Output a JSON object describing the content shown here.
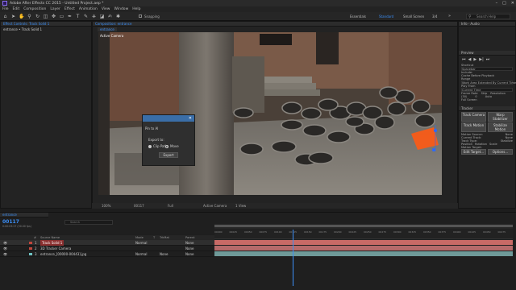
{
  "window": {
    "title": "Adobe After Effects CC 2015 - Untitled Project.aep *",
    "controls": [
      "–",
      "□",
      "✕"
    ]
  },
  "menu": [
    "File",
    "Edit",
    "Composition",
    "Layer",
    "Effect",
    "Animation",
    "View",
    "Window",
    "Help"
  ],
  "toolbar": {
    "snapping_label": "Snapping",
    "workspaces": [
      "Essentials",
      "Standard",
      "Small Screen",
      "3/4"
    ],
    "active_workspace": "Standard",
    "search_placeholder": "Search Help"
  },
  "effect_controls": {
    "tab": "Effect Controls: Track Solid 1",
    "layer": "entrance • Track Solid 1"
  },
  "composition": {
    "tab": "Composition: entrance",
    "comp_label": "entrance",
    "camera_label": "Active Camera",
    "footer": {
      "zoom": "100%",
      "timecode": "00117",
      "resolution": "Full",
      "view": "Active Camera",
      "views": "1 View"
    }
  },
  "dialog": {
    "title": "Pin to Al",
    "subtitle": "Export to:",
    "options": [
      "Clip Path",
      "Move"
    ],
    "selected": "Clip Path",
    "button": "Export"
  },
  "right_panel": {
    "info_tab": "Info",
    "audio_tab": "Audio",
    "preview_tab": "Preview",
    "shortcut_label": "Shortcut",
    "shortcut_value": "Spacebar",
    "include_label": "Include:",
    "cache_label": "Cache Before Playback",
    "range_label": "Range",
    "range_value": "Work Area Extended By Current Time",
    "play_from_label": "Play From",
    "play_from_value": "Current Time",
    "frame_rate_label": "Frame Rate",
    "skip_label": "Skip",
    "resolution_label": "Resolution",
    "frame_rate_value": "(30)",
    "skip_value": "0",
    "resolution_value": "Auto",
    "full_screen_label": "Full Screen",
    "tracker_tab": "Tracker",
    "tracker_buttons": [
      "Track Camera",
      "Warp Stabilizer",
      "Track Motion",
      "Stabilize Motion"
    ],
    "motion_source_label": "Motion Source:",
    "motion_source_value": "None",
    "current_track_label": "Current Track:",
    "current_track_value": "None",
    "track_type_label": "Track Type:",
    "track_type_value": "Stabilize",
    "position_label": "Position",
    "rotation_label": "Rotation",
    "scale_label": "Scale",
    "motion_target_label": "Motion Target:",
    "edit_target_label": "Edit Target...",
    "options_label": "Options..."
  },
  "timeline": {
    "tab": "entrance",
    "timecode": "00117",
    "timecode_sub": "0:00:03:27 (30.00 fps)",
    "search_placeholder": "Search",
    "columns": [
      "#",
      "Source Name",
      "Mode",
      "T",
      "TrkMat",
      "Parent"
    ],
    "ruler": [
      "00000",
      "00025",
      "00050",
      "00075",
      "00100",
      "00125",
      "00150",
      "00175",
      "00200",
      "00225",
      "00250",
      "00275",
      "00300",
      "00325",
      "00350",
      "00375",
      "00400",
      "00425",
      "00450",
      "00475"
    ],
    "playhead_fraction": 0.263,
    "layers": [
      {
        "num": "1",
        "name": "Track Solid 1",
        "mode": "Normal",
        "trkmat": "",
        "parent": "None",
        "color": "#c0463c",
        "bar": "#c86a66"
      },
      {
        "num": "2",
        "name": "3D Tracker Camera",
        "mode": "",
        "trkmat": "",
        "parent": "None",
        "color": "#c0463c",
        "bar": "#b56a6a"
      },
      {
        "num": "3",
        "name": "entrance_[00000-00443].jpg",
        "mode": "Normal",
        "trkmat": "None",
        "parent": "None",
        "color": "#6ec3c3",
        "bar": "#6f9a99"
      }
    ]
  }
}
